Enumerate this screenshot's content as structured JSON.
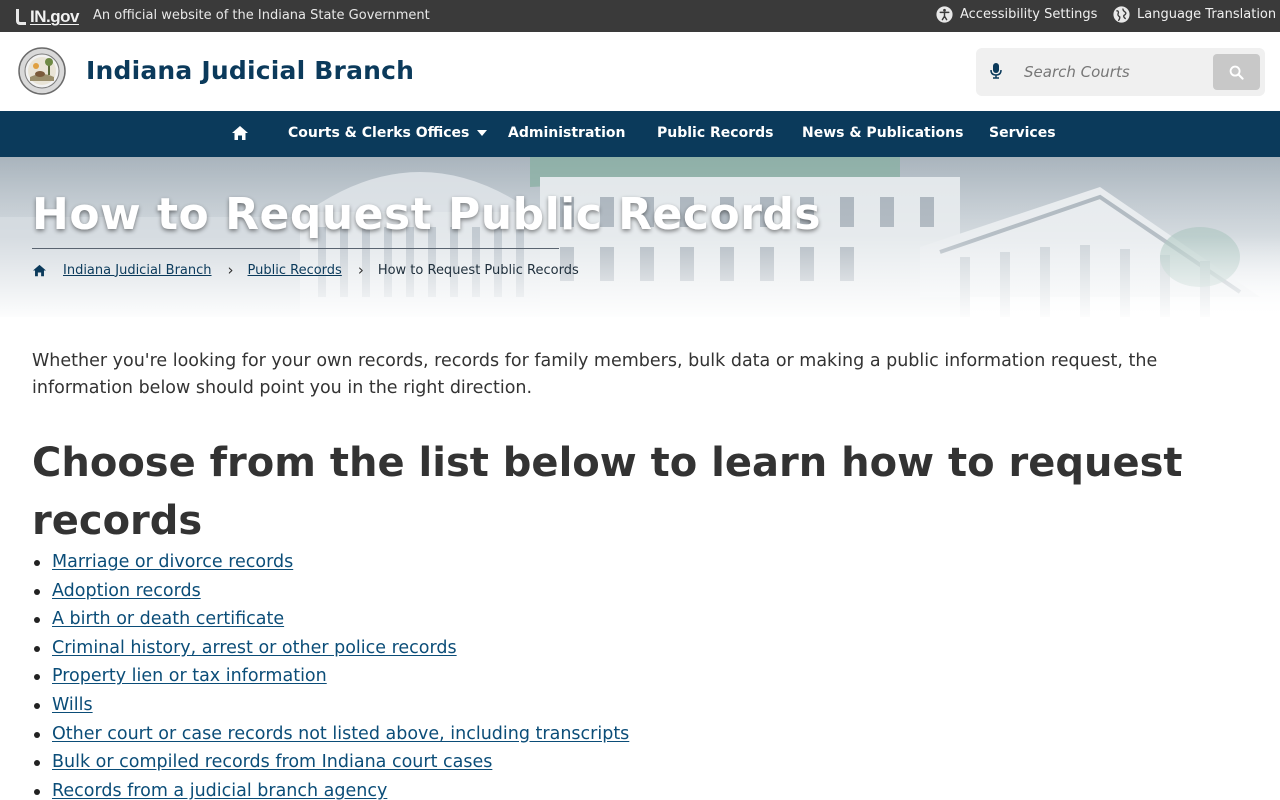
{
  "statebar": {
    "ingov": "IN.gov",
    "official": "An official website of the Indiana State Government",
    "accessibility": "Accessibility Settings",
    "language": "Language Translation"
  },
  "header": {
    "title": "Indiana Judicial Branch",
    "search_placeholder": "Search Courts"
  },
  "nav": {
    "items": [
      {
        "label": "Courts & Clerks Offices"
      },
      {
        "label": "Administration"
      },
      {
        "label": "Public Records"
      },
      {
        "label": "News & Publications"
      },
      {
        "label": "Services"
      }
    ]
  },
  "hero": {
    "title": "How to Request Public Records",
    "breadcrumbs": [
      "Indiana Judicial Branch",
      "Public Records",
      "How to Request Public Records"
    ]
  },
  "content": {
    "intro": "Whether you're looking for your own records, records for family members, bulk data or making a public information request, the information below should point you in the right direction.",
    "heading": "Choose from the list below to learn how to request records",
    "links": [
      "Marriage or divorce records",
      "Adoption records",
      "A birth or death certificate",
      "Criminal history, arrest or other police records",
      "Property lien or tax information",
      "Wills",
      "Other court or case records not listed above, including transcripts",
      "Bulk or compiled records from Indiana court cases",
      "Records from a judicial branch agency"
    ]
  },
  "colors": {
    "brand_navy": "#0b3a5b",
    "statebar": "#3a3a3a",
    "link": "#0b4d78"
  }
}
